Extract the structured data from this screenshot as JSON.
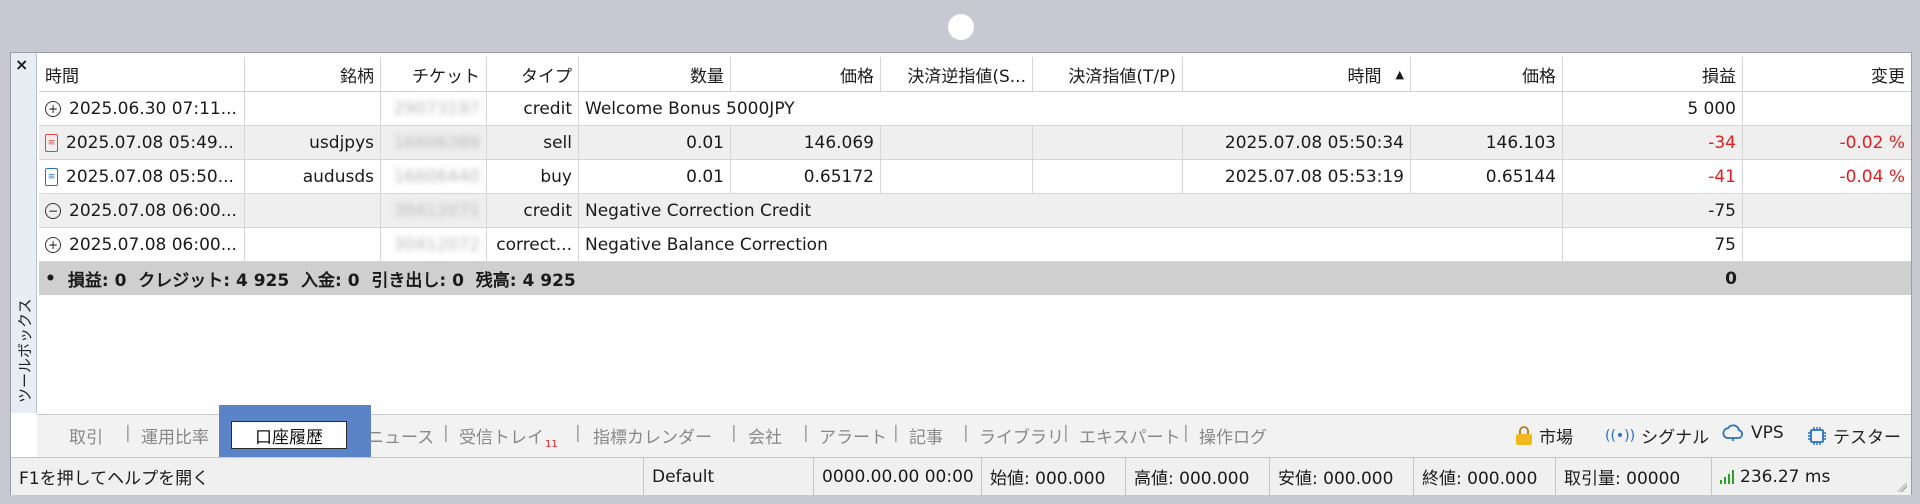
{
  "toolbox": {
    "close_label": "×",
    "side_label": "ツールボックス"
  },
  "table": {
    "headers": [
      "時間",
      "銘柄",
      "チケット",
      "タイプ",
      "数量",
      "価格",
      "決済逆指値(S...",
      "決済指値(T/P)",
      "時間",
      "価格",
      "損益",
      "変更"
    ],
    "sort_indicator": "▲",
    "rows": [
      {
        "icon": "plus-circle",
        "time": "2025.06.30 07:11...",
        "symbol": "",
        "ticket": "29073197",
        "type": "credit",
        "comment": "Welcome Bonus 5000JPY",
        "profit": "5 000",
        "change": ""
      },
      {
        "icon": "sell-doc",
        "time": "2025.07.08 05:49...",
        "symbol": "usdjpys",
        "ticket": "16606389",
        "type": "sell",
        "volume": "0.01",
        "price": "146.069",
        "sl": "",
        "tp": "",
        "close_time": "2025.07.08 05:50:34",
        "close_price": "146.103",
        "profit": "-34",
        "change": "-0.02 %"
      },
      {
        "icon": "buy-doc",
        "time": "2025.07.08 05:50...",
        "symbol": "audusds",
        "ticket": "16606440",
        "type": "buy",
        "volume": "0.01",
        "price": "0.65172",
        "sl": "",
        "tp": "",
        "close_time": "2025.07.08 05:53:19",
        "close_price": "0.65144",
        "profit": "-41",
        "change": "-0.04 %"
      },
      {
        "icon": "minus-circle",
        "time": "2025.07.08 06:00...",
        "symbol": "",
        "ticket": "30412071",
        "type": "credit",
        "comment": "Negative Correction Credit",
        "profit": "-75",
        "change": ""
      },
      {
        "icon": "plus-circle",
        "time": "2025.07.08 06:00...",
        "symbol": "",
        "ticket": "30412072",
        "type": "correct...",
        "comment": "Negative Balance Correction",
        "profit": "75",
        "change": ""
      }
    ],
    "summary": {
      "bullet": "•",
      "text": "損益: 0  クレジット: 4 925  入金: 0  引き出し: 0  残高: 4 925",
      "profit": "0"
    }
  },
  "tabs": {
    "items": [
      "取引",
      "運用比率",
      "口座履歴",
      "ニュース",
      "受信トレイ",
      "指標カレンダー",
      "会社",
      "アラート",
      "記事",
      "ライブラリ",
      "エキスパート",
      "操作ログ"
    ],
    "inbox_badge": "11",
    "active": "口座履歴",
    "right": [
      "市場",
      "シグナル",
      "VPS",
      "テスター"
    ]
  },
  "status_bar": {
    "help": "F1を押してヘルプを開く",
    "profile": "Default",
    "datetime": "0000.00.00 00:00",
    "open": "始値: 000.000",
    "high": "高値: 000.000",
    "low": "安値: 000.000",
    "close": "終値: 000.000",
    "volume": "取引量: 00000",
    "ping": "236.27 ms"
  },
  "colors": {
    "negative": "#e02020",
    "highlight": "#5b84c8",
    "signal_green": "#2aa02a"
  }
}
